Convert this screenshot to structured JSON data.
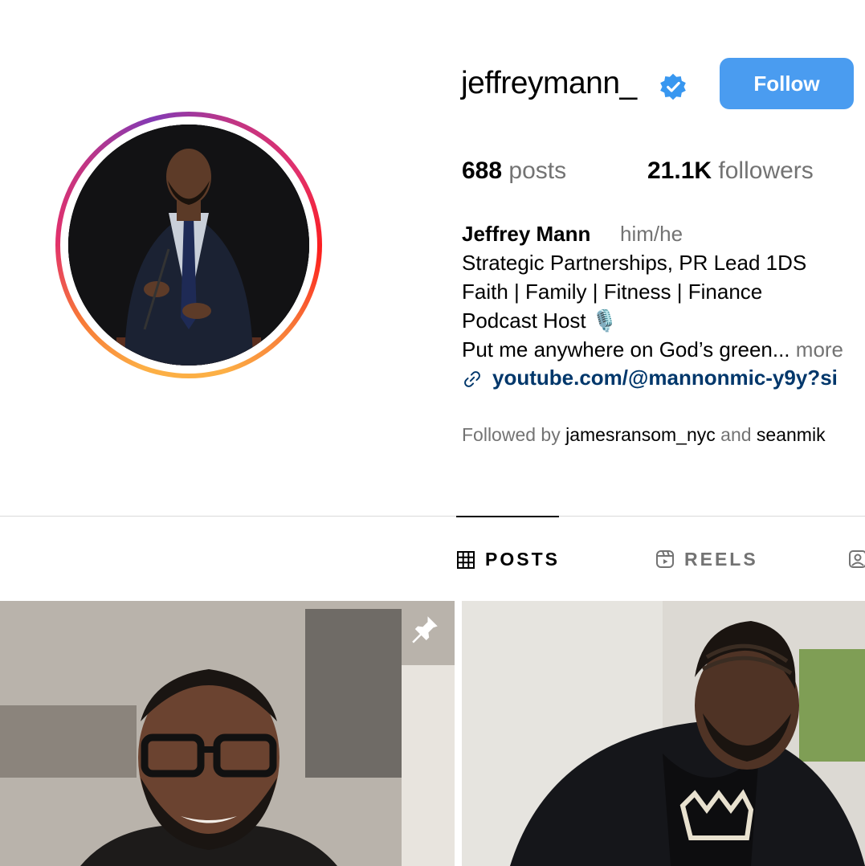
{
  "profile": {
    "username": "jeffreymann_",
    "follow_label": "Follow",
    "stats": {
      "posts_count": "688",
      "posts_label": "posts",
      "followers_count": "21.1K",
      "followers_label": "followers"
    },
    "bio": {
      "name": "Jeffrey Mann",
      "pronouns": "him/he",
      "line1": "Strategic Partnerships, PR Lead 1DS",
      "line2": "Faith | Family | Fitness | Finance",
      "line3": "Podcast Host 🎙️",
      "line4": "Put me anywhere on God’s green...",
      "more_label": "more",
      "link": "youtube.com/@mannonmic-y9y?si"
    },
    "followed_by": {
      "prefix": "Followed by",
      "user1": "jamesransom_nyc",
      "conj": "and",
      "user2": "seanmik"
    }
  },
  "tabs": [
    {
      "label": "POSTS",
      "icon": "grid-icon",
      "active": true
    },
    {
      "label": "REELS",
      "icon": "reels-icon",
      "active": false
    }
  ],
  "colors": {
    "follow_button": "#4a9cf0",
    "link": "#00376b",
    "verified": "#3897f0",
    "secondary_text": "#737373"
  }
}
